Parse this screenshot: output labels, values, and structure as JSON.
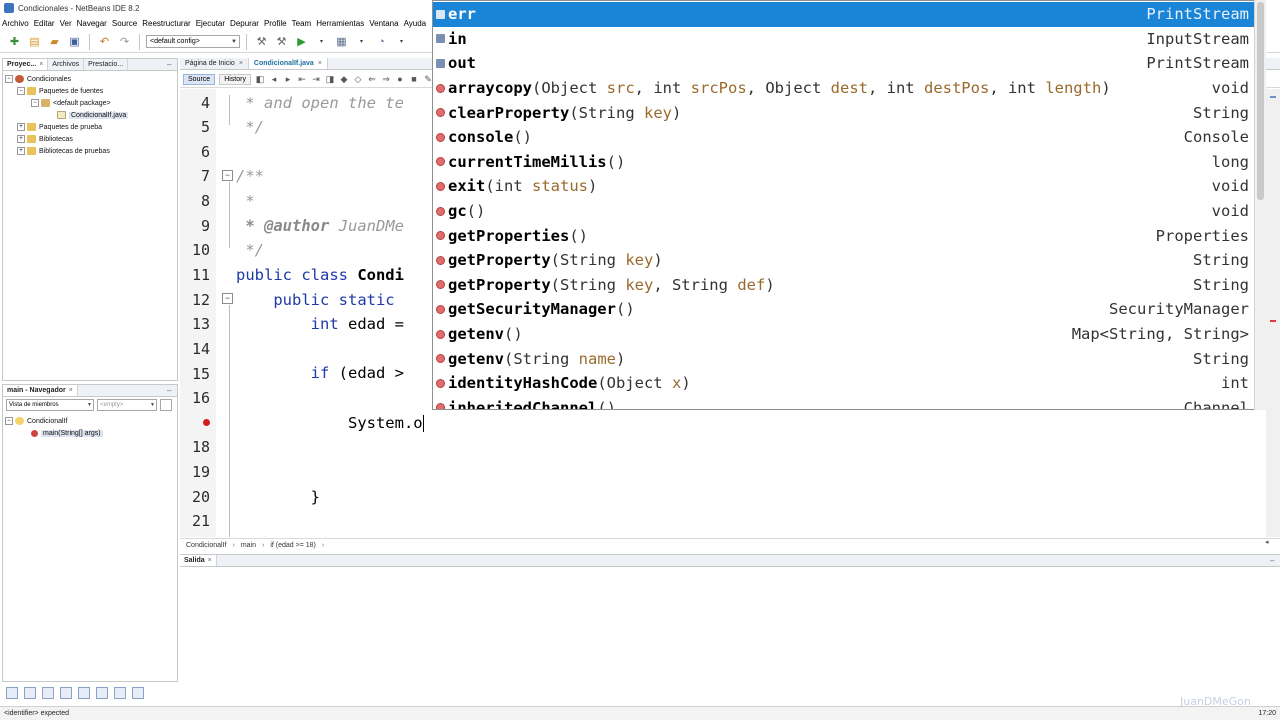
{
  "window": {
    "title": "Condicionales - NetBeans IDE 8.2"
  },
  "menu": [
    "Archivo",
    "Editar",
    "Ver",
    "Navegar",
    "Source",
    "Reestructurar",
    "Ejecutar",
    "Depurar",
    "Profile",
    "Team",
    "Herramientas",
    "Ventana",
    "Ayuda"
  ],
  "toolbar": {
    "config_value": "<default config>"
  },
  "projects_panel": {
    "tabs": [
      "Proyec...",
      "Archivos",
      "Prestacio..."
    ],
    "tree": [
      {
        "label": "Condicionales",
        "icon": "project-icon"
      },
      {
        "label": "Paquetes de fuentes",
        "icon": "folder-icon"
      },
      {
        "label": "<default package>",
        "icon": "package-icon"
      },
      {
        "label": "CondicionalIf.java",
        "icon": "java-file-icon"
      },
      {
        "label": "Paquetes de prueba",
        "icon": "folder-icon"
      },
      {
        "label": "Bibliotecas",
        "icon": "folder-icon"
      },
      {
        "label": "Bibliotecas de pruebas",
        "icon": "folder-icon"
      }
    ]
  },
  "navigator_panel": {
    "tab": "main - Navegador",
    "view_select": "Vista de miembros",
    "filter_select": "<empty>",
    "tree": [
      {
        "label": "CondicionalIf",
        "icon": "class-icon"
      },
      {
        "label": "main(String[] args)",
        "icon": "method-icon"
      }
    ]
  },
  "editor": {
    "tabs": [
      "Página de Inicio",
      "CondicionalIf.java"
    ],
    "source_button": "Source",
    "history_button": "History",
    "line_numbers": [
      "4",
      "5",
      "6",
      "7",
      "8",
      "9",
      "10",
      "11",
      "12",
      "13",
      "14",
      "15",
      "16",
      "",
      "18",
      "19",
      "20",
      "21"
    ],
    "lines": {
      "l4": " * and open the te",
      "l5": " */",
      "l7": "/**",
      "l8": " *",
      "l9_tag": " * @author",
      "l9_rest": " JuanDMe",
      "l10": " */",
      "l11_kw": "public class",
      "l11_name": " Condi",
      "l12_kw": "    public static",
      "l13_kw": "        int",
      "l13_rest": " edad =",
      "l15_kw": "        if",
      "l15_rest": " (edad >",
      "l17": "            System.o",
      "l20": "        }"
    },
    "breadcrumb": [
      "CondicionalIf",
      "main",
      "if (edad >= 18)"
    ]
  },
  "output_panel": {
    "tab": "Salida"
  },
  "autocomplete": {
    "items": [
      {
        "name": "err",
        "params": "",
        "return": "PrintStream",
        "kind": "field-icon"
      },
      {
        "name": "in",
        "params": "",
        "return": "InputStream",
        "kind": "field-icon"
      },
      {
        "name": "out",
        "params": "",
        "return": "PrintStream",
        "kind": "field-icon"
      },
      {
        "name": "arraycopy",
        "params": [
          "(Object ",
          "src",
          ", int ",
          "srcPos",
          ", Object ",
          "dest",
          ", int ",
          "destPos",
          ", int ",
          "length",
          ")"
        ],
        "return": "void",
        "kind": "method-icon"
      },
      {
        "name": "clearProperty",
        "params": [
          "(String ",
          "key",
          ")"
        ],
        "return": "String",
        "kind": "method-icon"
      },
      {
        "name": "console",
        "params": [
          "()"
        ],
        "return": "Console",
        "kind": "method-icon"
      },
      {
        "name": "currentTimeMillis",
        "params": [
          "()"
        ],
        "return": "long",
        "kind": "method-icon"
      },
      {
        "name": "exit",
        "params": [
          "(int ",
          "status",
          ")"
        ],
        "return": "void",
        "kind": "method-icon"
      },
      {
        "name": "gc",
        "params": [
          "()"
        ],
        "return": "void",
        "kind": "method-icon"
      },
      {
        "name": "getProperties",
        "params": [
          "()"
        ],
        "return": "Properties",
        "kind": "method-icon"
      },
      {
        "name": "getProperty",
        "params": [
          "(String ",
          "key",
          ")"
        ],
        "return": "String",
        "kind": "method-icon"
      },
      {
        "name": "getProperty",
        "params": [
          "(String ",
          "key",
          ", String ",
          "def",
          ")"
        ],
        "return": "String",
        "kind": "method-icon"
      },
      {
        "name": "getSecurityManager",
        "params": [
          "()"
        ],
        "return": "SecurityManager",
        "kind": "method-icon"
      },
      {
        "name": "getenv",
        "params": [
          "()"
        ],
        "return": "Map<String, String>",
        "kind": "method-icon"
      },
      {
        "name": "getenv",
        "params": [
          "(String ",
          "name",
          ")"
        ],
        "return": "String",
        "kind": "method-icon"
      },
      {
        "name": "identityHashCode",
        "params": [
          "(Object ",
          "x",
          ")"
        ],
        "return": "int",
        "kind": "method-icon"
      },
      {
        "name": "inheritedChannel",
        "params": [
          "()"
        ],
        "return": "Channel",
        "kind": "method-icon"
      }
    ]
  },
  "statusbar": {
    "message": "<identifier> expected",
    "time": "17:20"
  },
  "watermark": "JuanDMeGon",
  "colors": {
    "selection": "#1a84d6",
    "keyword": "#1e3aa6",
    "comment": "#9a9a9a"
  }
}
